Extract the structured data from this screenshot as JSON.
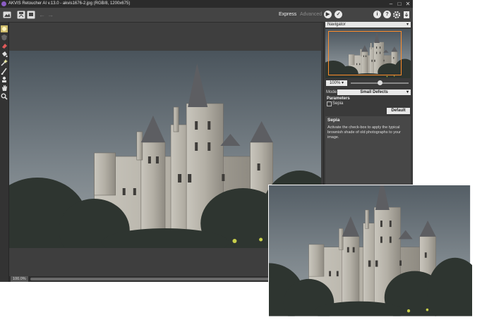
{
  "window": {
    "title": "AKVIS Retoucher AI v.13.0 - akvis1676-2.jpg (RGB/8, 1200x675)",
    "minimize": "–",
    "maximize": "□",
    "close": "✕"
  },
  "toolbar": {
    "mode_express": "Express",
    "mode_advanced": "Advanced",
    "run_label": "▶",
    "apply_label": "✓",
    "info_label": "i",
    "help_label": "?",
    "icons": [
      "open-image-icon",
      "save-image-icon",
      "print-icon",
      "undo-icon",
      "redo-icon",
      "settings-icon",
      "share-icon"
    ]
  },
  "tools": [
    "hand-tool-icon",
    "smart-brush-icon",
    "eraser-icon",
    "bucket-icon",
    "magic-wand-icon",
    "brush-icon",
    "clone-icon",
    "hand-icon",
    "zoom-icon"
  ],
  "statusbar": {
    "zoom": "100.0%"
  },
  "navigator": {
    "title": "Navigator",
    "zoom_value": "100%",
    "zoom_level": 0.5
  },
  "settings": {
    "mode_label": "Mode:",
    "mode_value": "Small Defects",
    "parameters_label": "Parameters",
    "sepia_label": "Sepia",
    "default_button": "Default"
  },
  "help": {
    "title": "Sepia",
    "text": "Activate the check-box to apply the typical brownish shade of old photographs to your image."
  },
  "colors": {
    "accent_orange": "#ff8c2a",
    "panel_dark": "#3a3a3a"
  }
}
